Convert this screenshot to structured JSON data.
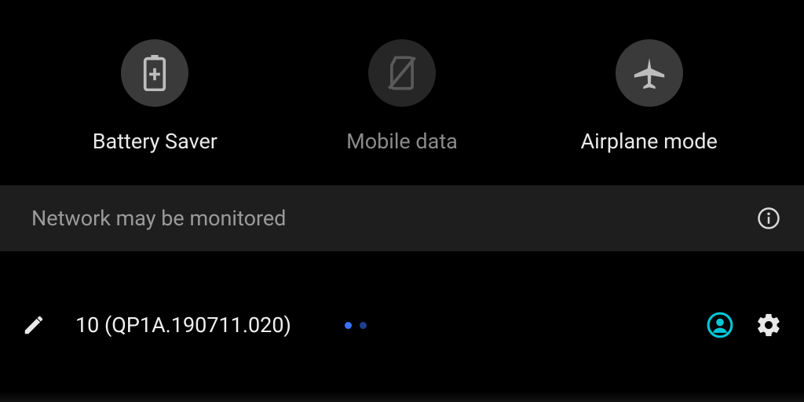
{
  "tiles": [
    {
      "label": "Battery Saver",
      "icon": "battery-plus-icon",
      "state": "enabled"
    },
    {
      "label": "Mobile data",
      "icon": "no-sim-icon",
      "state": "disabled"
    },
    {
      "label": "Airplane mode",
      "icon": "airplane-icon",
      "state": "enabled"
    }
  ],
  "banner": {
    "text": "Network may be monitored"
  },
  "footer": {
    "build": "10 (QP1A.190711.020)",
    "page_count": 2,
    "page_index": 0
  },
  "colors": {
    "accent": "#00c8d7",
    "page_dot": "#3a72ff"
  }
}
